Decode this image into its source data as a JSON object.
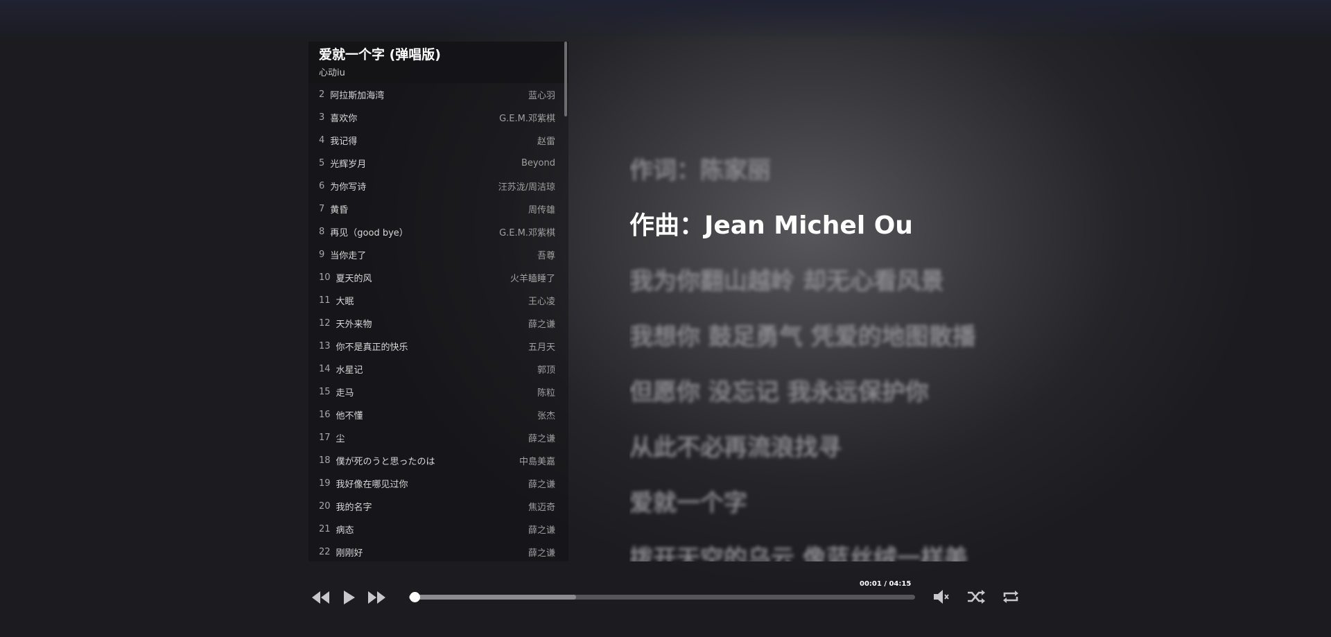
{
  "now_playing": {
    "title": "爱就一个字 (弹唱版)",
    "artist": "心动iu"
  },
  "playlist": [
    {
      "num": "2",
      "name": "阿拉斯加海湾",
      "artist": "蓝心羽"
    },
    {
      "num": "3",
      "name": "喜欢你",
      "artist": "G.E.M.邓紫棋"
    },
    {
      "num": "4",
      "name": "我记得",
      "artist": "赵雷"
    },
    {
      "num": "5",
      "name": "光辉岁月",
      "artist": "Beyond"
    },
    {
      "num": "6",
      "name": "为你写诗",
      "artist": "汪苏泷/周洁琼"
    },
    {
      "num": "7",
      "name": "黄昏",
      "artist": "周传雄"
    },
    {
      "num": "8",
      "name": "再见（good bye）",
      "artist": "G.E.M.邓紫棋"
    },
    {
      "num": "9",
      "name": "当你走了",
      "artist": "吾尊"
    },
    {
      "num": "10",
      "name": "夏天的风",
      "artist": "火羊瞌睡了"
    },
    {
      "num": "11",
      "name": "大眠",
      "artist": "王心凌"
    },
    {
      "num": "12",
      "name": "天外来物",
      "artist": "薛之谦"
    },
    {
      "num": "13",
      "name": "你不是真正的快乐",
      "artist": "五月天"
    },
    {
      "num": "14",
      "name": "水星记",
      "artist": "郭顶"
    },
    {
      "num": "15",
      "name": "走马",
      "artist": "陈粒"
    },
    {
      "num": "16",
      "name": "他不懂",
      "artist": "张杰"
    },
    {
      "num": "17",
      "name": "尘",
      "artist": "薛之谦"
    },
    {
      "num": "18",
      "name": "僕が死のうと思ったのは",
      "artist": "中島美嘉"
    },
    {
      "num": "19",
      "name": "我好像在哪见过你",
      "artist": "薛之谦"
    },
    {
      "num": "20",
      "name": "我的名字",
      "artist": "焦迈奇"
    },
    {
      "num": "21",
      "name": "病态",
      "artist": "薛之谦"
    },
    {
      "num": "22",
      "name": "刚刚好",
      "artist": "薛之谦"
    }
  ],
  "lyrics": [
    "作词：陈家丽",
    "作曲：Jean Michel Ou",
    "我为你翻山越岭 却无心看风景",
    "我想你 鼓足勇气 凭爱的地图散播",
    "但愿你 没忘记 我永远保护你",
    "从此不必再流浪找寻",
    "爱就一个字",
    "拨开天空的乌云 像蓝丝绒一样美"
  ],
  "active_lyric_index": 1,
  "player": {
    "time_display": "00:01 / 04:15",
    "elapsed_fraction": 0.004,
    "buffered_fraction": 0.33
  },
  "icons": {
    "prev": "rewind-icon",
    "play": "play-icon",
    "next": "fast-forward-icon",
    "volume": "volume-icon",
    "shuffle": "shuffle-icon",
    "repeat": "repeat-icon"
  }
}
